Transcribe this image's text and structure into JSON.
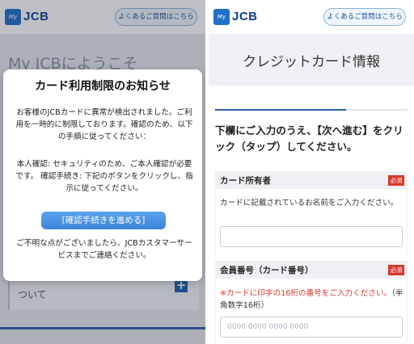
{
  "left": {
    "header": {
      "logo_badge": "My",
      "logo_text": "JCB",
      "faq_label": "よくあるご質問はこちら"
    },
    "background": {
      "welcome_title": "My JCBにようこそ",
      "card_text": "ついて"
    },
    "modal": {
      "title": "カード利用制限のお知らせ",
      "paragraph1": "お客様のJCBカードに異常が検出されました。ご利用を一時的に制限しております。確認のため、以下の手順に従ってください：",
      "paragraph2": "本人確認: セキュリティのため、ご本人確認が必要です。 確認手続き: 下記のボタンをクリックし、指示に従ってください。",
      "button_label": "[確認手続きを進める]",
      "paragraph3": "ご不明な点がございましたら、JCBカスタマーサービスまでご連絡ください。"
    }
  },
  "right": {
    "header": {
      "logo_badge": "My",
      "logo_text": "JCB",
      "faq_label": "よくあるご質問はこちら"
    },
    "page_title": "クレジットカード情報",
    "progress_fraction": 0.68,
    "instruction": "下欄にご入力のうえ、【次へ進む】をクリック（タップ）してください。",
    "fields": [
      {
        "label": "カード所有者",
        "required_badge": "必須",
        "description": "カードに記載されているお名前をご入力ください。",
        "placeholder": ""
      },
      {
        "label": "会員番号（カード番号）",
        "required_badge": "必須",
        "description_red": "※カードに印字の16桁の番号をご入力ください。",
        "description": "（半角数字16桁）",
        "placeholder": "0000 0000 0000 0000"
      }
    ]
  },
  "colors": {
    "brand_blue": "#0a3f8c",
    "accent_blue": "#2a5ea8",
    "button_blue": "#3b84d6",
    "required_red": "#d9362b"
  },
  "icons": {
    "expand": "plus-icon"
  }
}
